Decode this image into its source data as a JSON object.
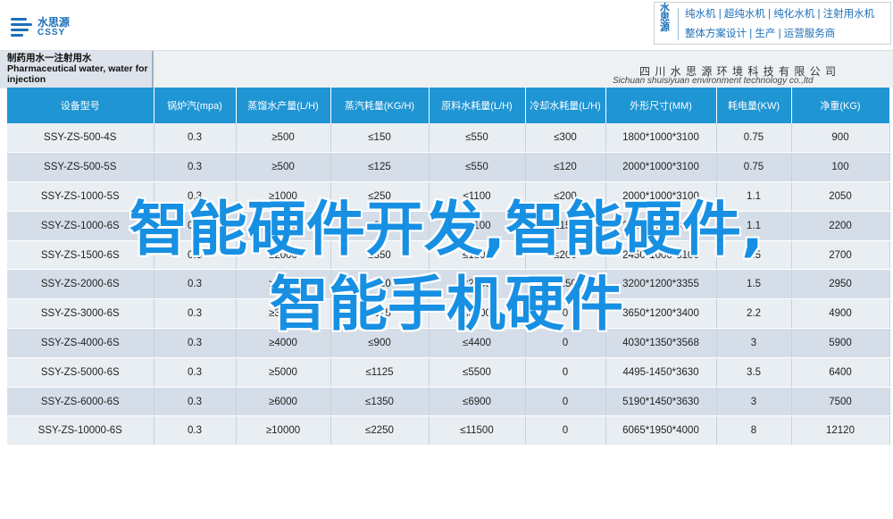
{
  "logo": {
    "cn": "水思源",
    "en": "CSSY"
  },
  "brand": {
    "vertical": "水思源",
    "line1": "纯水机 | 超纯水机 | 纯化水机 | 注射用水机",
    "line2": "整体方案设计 | 生产 | 运营服务商"
  },
  "title": {
    "line1": "制药用水一注射用水",
    "line2": "Pharmaceutical water, water for",
    "line3": "injection"
  },
  "company": {
    "cn": "四 川 水 思 源 环 境 科 技 有 限 公 司",
    "en": "Sichuan shuisiyuan environment technology co.,ltd"
  },
  "table": {
    "headers": [
      "设备型号",
      "锅炉汽(mpa)",
      "蒸馏水产量(L/H)",
      "蒸汽耗量(KG/H)",
      "原料水耗量(L/H)",
      "冷却水耗量(L/H)",
      "外形尺寸(MM)",
      "耗电量(KW)",
      "净重(KG)"
    ],
    "rows": [
      [
        "SSY-ZS-500-4S",
        "0.3",
        "≥500",
        "≤150",
        "≤550",
        "≤300",
        "1800*1000*3100",
        "0.75",
        "900"
      ],
      [
        "SSY-ZS-500-5S",
        "0.3",
        "≥500",
        "≤125",
        "≤550",
        "≤120",
        "2000*1000*3100",
        "0.75",
        "100"
      ],
      [
        "SSY-ZS-1000-5S",
        "0.3",
        "≥1000",
        "≤250",
        "≤1100",
        "≤200",
        "2000*1000*3100",
        "1.1",
        "2050"
      ],
      [
        "SSY-ZS-1000-6S",
        "0.3",
        "≥1000",
        "≤250",
        "≤1100",
        "≤150",
        "2300*1000*3100",
        "1.1",
        "2200"
      ],
      [
        "SSY-ZS-1500-6S",
        "0.3",
        "≥2000",
        "≤350",
        "≤1800",
        "≤200",
        "2450*1000*3100",
        "1.5",
        "2700"
      ],
      [
        "SSY-ZS-2000-6S",
        "0.3",
        "≥2000",
        "≤450",
        "≤2200",
        "≤250",
        "3200*1200*3355",
        "1.5",
        "2950"
      ],
      [
        "SSY-ZS-3000-6S",
        "0.3",
        "≥3000",
        "≤675",
        "≤3300",
        "0",
        "3650*1200*3400",
        "2.2",
        "4900"
      ],
      [
        "SSY-ZS-4000-6S",
        "0.3",
        "≥4000",
        "≤900",
        "≤4400",
        "0",
        "4030*1350*3568",
        "3",
        "5900"
      ],
      [
        "SSY-ZS-5000-6S",
        "0.3",
        "≥5000",
        "≤1125",
        "≤5500",
        "0",
        "4495-1450*3630",
        "3.5",
        "6400"
      ],
      [
        "SSY-ZS-6000-6S",
        "0.3",
        "≥6000",
        "≤1350",
        "≤6900",
        "0",
        "5190*1450*3630",
        "3",
        "7500"
      ],
      [
        "SSY-ZS-10000-6S",
        "0.3",
        "≥10000",
        "≤2250",
        "≤11500",
        "0",
        "6065*1950*4000",
        "8",
        "12120"
      ]
    ]
  },
  "overlay": {
    "line1": "智能硬件开发,智能硬件,",
    "line2": "智能手机硬件"
  }
}
